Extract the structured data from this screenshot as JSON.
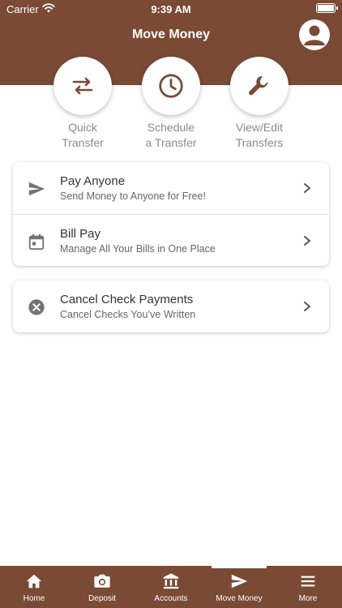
{
  "status": {
    "carrier": "Carrier",
    "time": "9:39 AM"
  },
  "header": {
    "title": "Move Money"
  },
  "quick_actions": [
    {
      "label_line1": "Quick",
      "label_line2": "Transfer",
      "icon": "swap-arrows-icon"
    },
    {
      "label_line1": "Schedule",
      "label_line2": "a Transfer",
      "icon": "clock-icon"
    },
    {
      "label_line1": "View/Edit",
      "label_line2": "Transfers",
      "icon": "wrench-icon"
    }
  ],
  "card1": [
    {
      "title": "Pay Anyone",
      "subtitle": "Send Money to Anyone for Free!",
      "icon": "send-icon"
    },
    {
      "title": "Bill Pay",
      "subtitle": "Manage All Your Bills in One Place",
      "icon": "calendar-icon"
    }
  ],
  "card2": [
    {
      "title": "Cancel Check Payments",
      "subtitle": "Cancel Checks You’ve Written",
      "icon": "cancel-circle-icon"
    }
  ],
  "tabs": [
    {
      "label": "Home",
      "icon": "home-icon"
    },
    {
      "label": "Deposit",
      "icon": "camera-icon"
    },
    {
      "label": "Accounts",
      "icon": "bank-icon"
    },
    {
      "label": "Move Money",
      "icon": "send-icon",
      "active": true
    },
    {
      "label": "More",
      "icon": "menu-icon"
    }
  ],
  "colors": {
    "brand": "#7a4a35",
    "muted_text": "#8a8a8a",
    "icon_gray": "#737373"
  }
}
